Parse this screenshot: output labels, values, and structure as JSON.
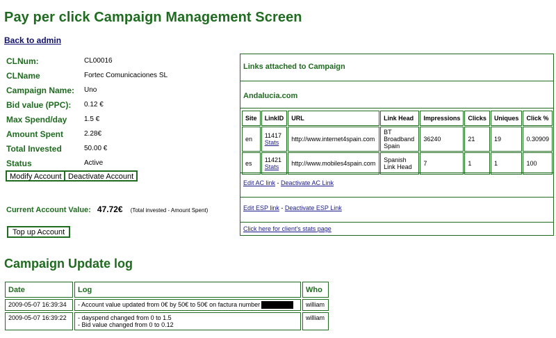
{
  "page": {
    "title": "Pay per click Campaign Management Screen",
    "back_link": "Back to admin"
  },
  "account": {
    "fields": [
      {
        "label": "CLNum:",
        "value": "CL00016"
      },
      {
        "label": "CLName",
        "value": "Fortec Comunicaciones SL"
      },
      {
        "label": "Campaign Name:",
        "value": "Uno"
      },
      {
        "label": "Bid value (PPC):",
        "value": "0.12 €"
      },
      {
        "label": "Max Spend/day",
        "value": "1.5 €"
      },
      {
        "label": "Amount Spent",
        "value": "2.28€"
      },
      {
        "label": "Total Invested",
        "value": "50.00 €"
      },
      {
        "label": "Status",
        "value": "Active"
      }
    ],
    "modify_button": "Modify Account",
    "deactivate_button": "Deactivate Account",
    "current_value_label": "Current Account Value:",
    "current_value": "47.72€",
    "current_value_note": "(Total invested - Amount Spent)",
    "topup_button": "Top up Account"
  },
  "links_panel": {
    "title": "Links attached to Campaign",
    "campaign_site": "Andalucia.com",
    "headers": [
      "Site",
      "LinkID",
      "URL",
      "Link Head",
      "Impressions",
      "Clicks",
      "Uniques",
      "Click %"
    ],
    "rows": [
      {
        "site": "en",
        "link_id": "11417",
        "stats": "Stats",
        "url": "http://www.internet4spain.com",
        "link_head": "BT Broadband Spain",
        "impressions": "36240",
        "clicks": "21",
        "uniques": "19",
        "click_pct": "0.30909"
      },
      {
        "site": "es",
        "link_id": "11421",
        "stats": "Stats",
        "url": "http://www.mobiles4spain.com",
        "link_head": "Spanish Link Head",
        "impressions": "7",
        "clicks": "1",
        "uniques": "1",
        "click_pct": "100"
      }
    ],
    "edit_ac": "Edit AC link",
    "deactivate_ac": "Deactivate AC Link",
    "edit_esp": "Edit ESP link",
    "deactivate_esp": "Deactivate ESP Link",
    "sep": " - ",
    "stats_page": "Click here for client's stats page"
  },
  "log": {
    "title": "Campaign Update log",
    "headers": [
      "Date",
      "Log",
      "Who"
    ],
    "rows": [
      {
        "date": "2009-05-07 16:39:34",
        "lines": [
          "- Account value updated from 0€ by 50€ to 50€ on factura number"
        ],
        "who": "william"
      },
      {
        "date": "2009-05-07 16:39:22",
        "lines": [
          "- dayspend changed from 0 to 1.5",
          "- Bid value changed from 0 to 0.12"
        ],
        "who": "william"
      }
    ]
  }
}
